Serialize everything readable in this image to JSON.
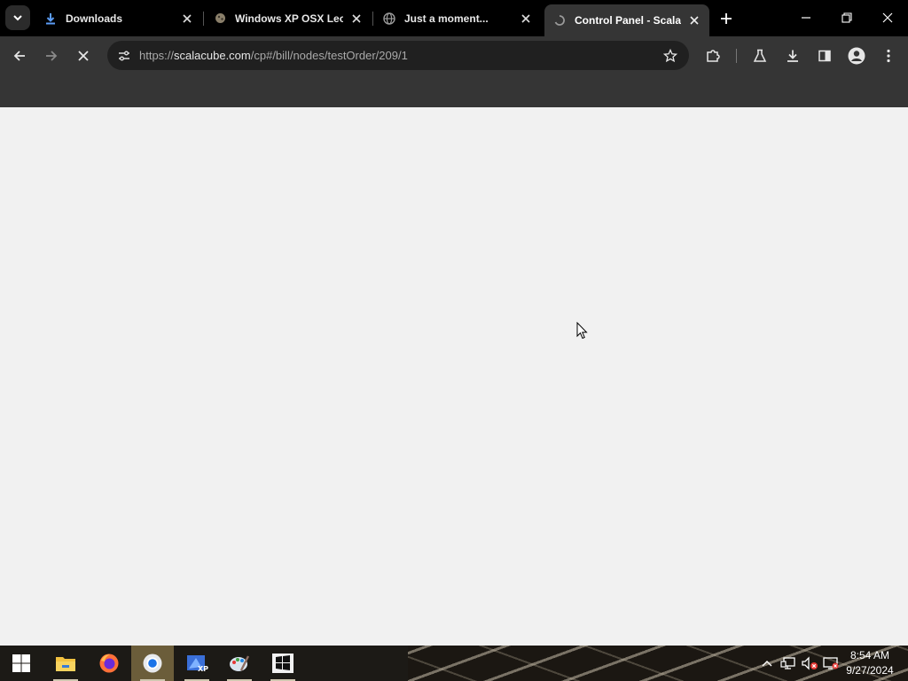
{
  "browser": {
    "tabs": [
      {
        "title": "Downloads",
        "favicon": "download-icon",
        "active": false
      },
      {
        "title": "Windows XP OSX Leop",
        "favicon": "leopard-icon",
        "active": false
      },
      {
        "title": "Just a moment...",
        "favicon": "globe-icon",
        "active": false
      },
      {
        "title": "Control Panel - ScalaC",
        "favicon": "loading-icon",
        "active": true
      }
    ],
    "address": {
      "scheme": "https://",
      "host": "scalacube.com",
      "path": "/cp#/bill/nodes/testOrder/209/1"
    },
    "page_state": "loading"
  },
  "taskbar": {
    "apps": [
      "windows-start-icon",
      "file-explorer-icon",
      "firefox-icon",
      "chrome-icon",
      "windows-xp-app-icon",
      "paint-icon",
      "windows-logo-app-icon"
    ],
    "clock": {
      "time": "8:54 AM",
      "date": "9/27/2024"
    }
  },
  "colors": {
    "tabstrip": "#000000",
    "toolbar": "#353535",
    "omnibox": "#202020",
    "content": "#f1f1f1"
  }
}
